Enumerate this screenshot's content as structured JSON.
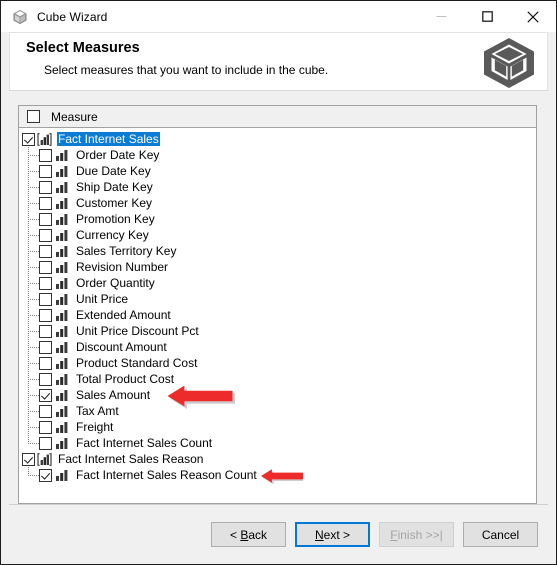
{
  "window": {
    "title": "Cube Wizard",
    "icon": "cube-icon",
    "controls": {
      "minimize": "minimize-icon",
      "maximize": "maximize-icon",
      "close": "close-icon"
    }
  },
  "banner": {
    "title": "Select Measures",
    "subtitle": "Select measures that you want to include in the cube.",
    "logo": "cube-logo-icon"
  },
  "grid": {
    "header_label": "Measure",
    "header_checked": false,
    "selection_color": "#0c7cd5"
  },
  "tree": {
    "groups": [
      {
        "label": "Fact Internet Sales",
        "checked": true,
        "selected": true,
        "items": [
          {
            "label": "Order Date Key",
            "checked": false
          },
          {
            "label": "Due Date Key",
            "checked": false
          },
          {
            "label": "Ship Date Key",
            "checked": false
          },
          {
            "label": "Customer Key",
            "checked": false
          },
          {
            "label": "Promotion Key",
            "checked": false
          },
          {
            "label": "Currency Key",
            "checked": false
          },
          {
            "label": "Sales Territory Key",
            "checked": false
          },
          {
            "label": "Revision Number",
            "checked": false
          },
          {
            "label": "Order Quantity",
            "checked": false
          },
          {
            "label": "Unit Price",
            "checked": false
          },
          {
            "label": "Extended Amount",
            "checked": false
          },
          {
            "label": "Unit Price Discount Pct",
            "checked": false
          },
          {
            "label": "Discount Amount",
            "checked": false
          },
          {
            "label": "Product Standard Cost",
            "checked": false
          },
          {
            "label": "Total Product Cost",
            "checked": false
          },
          {
            "label": "Sales Amount",
            "checked": true,
            "annotated": true
          },
          {
            "label": "Tax Amt",
            "checked": false
          },
          {
            "label": "Freight",
            "checked": false
          },
          {
            "label": "Fact Internet Sales Count",
            "checked": false
          }
        ]
      },
      {
        "label": "Fact Internet Sales Reason",
        "checked": true,
        "selected": false,
        "items": [
          {
            "label": "Fact Internet Sales Reason Count",
            "checked": true,
            "annotated": true
          }
        ]
      }
    ]
  },
  "footer": {
    "buttons": [
      {
        "id": "back",
        "label": "< Back",
        "accel": "B",
        "state": "normal"
      },
      {
        "id": "next",
        "label": "Next >",
        "accel": "N",
        "state": "default"
      },
      {
        "id": "finish",
        "label": "Finish >>|",
        "accel": "F",
        "state": "disabled"
      },
      {
        "id": "cancel",
        "label": "Cancel",
        "accel": "",
        "state": "normal"
      }
    ]
  },
  "annotations": {
    "arrow_color": "#ee2b2b",
    "count": 2
  }
}
